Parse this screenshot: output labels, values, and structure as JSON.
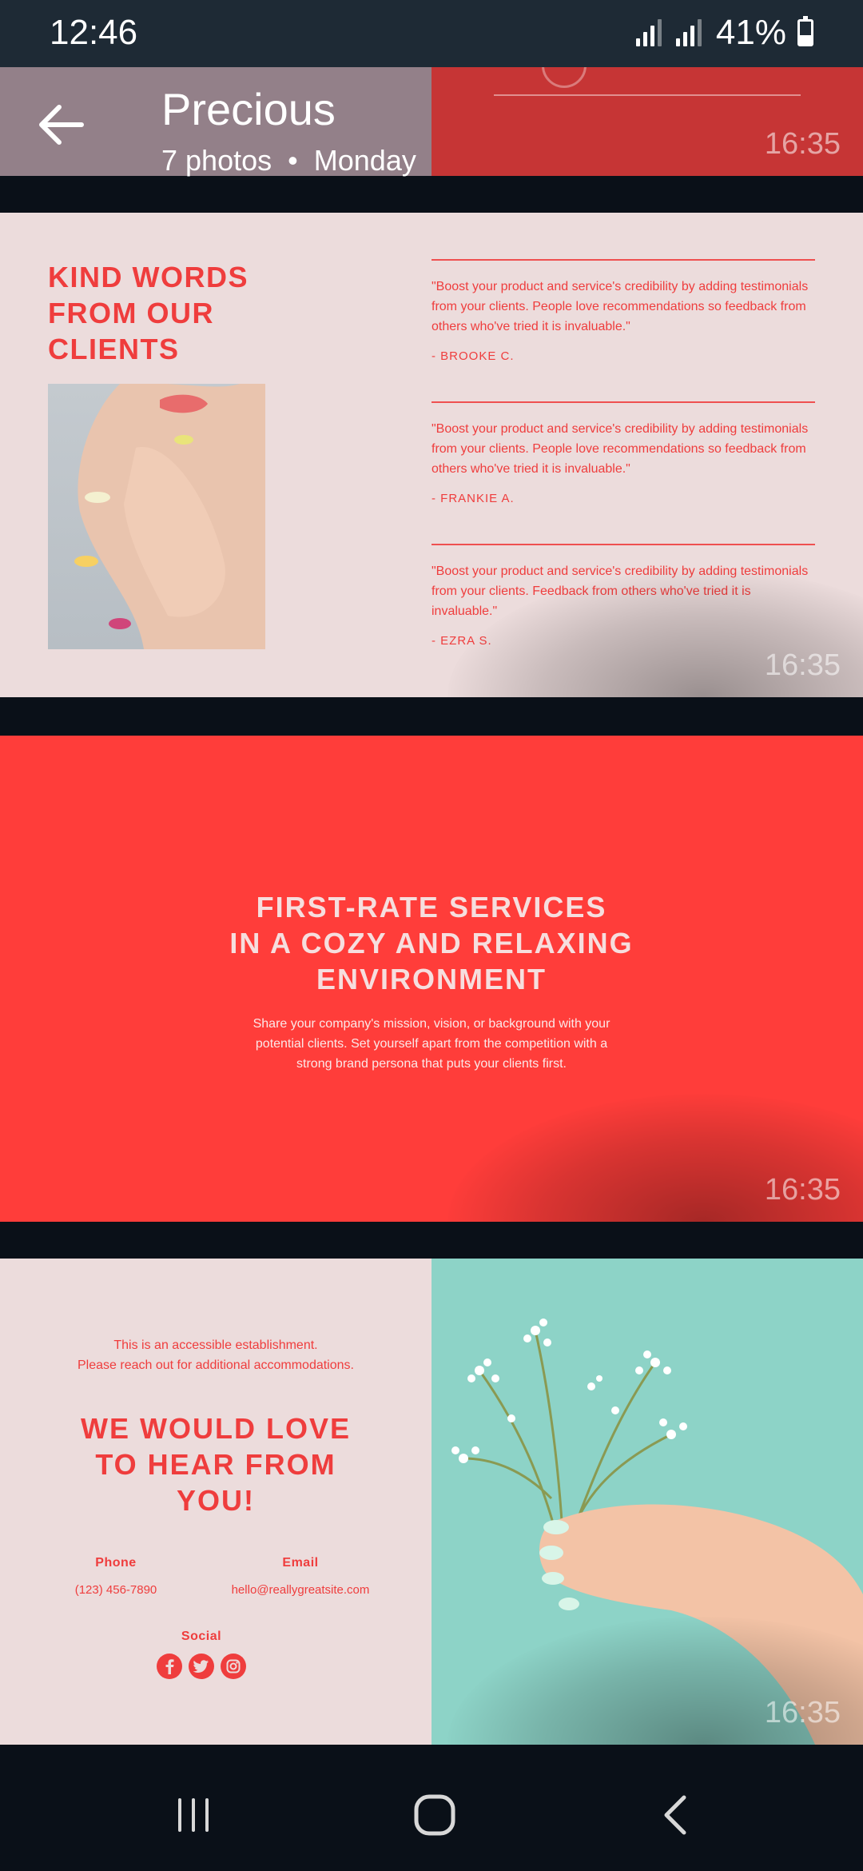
{
  "status_bar": {
    "time": "12:46",
    "battery": "41%",
    "battery_level": 0.41
  },
  "album": {
    "title": "Precious",
    "photo_count": "7 photos",
    "separator": "•",
    "date": "Monday"
  },
  "photos": [
    {
      "time": "16:35"
    },
    {
      "time": "16:35",
      "heading": "KIND WORDS FROM OUR CLIENTS",
      "testimonials": [
        {
          "quote": "\"Boost your product and service's credibility by adding testimonials from your clients. People love recommendations so feedback from others who've tried it is invaluable.\"",
          "author": "- BROOKE C."
        },
        {
          "quote": "\"Boost your product and service's credibility by adding testimonials from your clients. People love recommendations so feedback from others who've tried it is invaluable.\"",
          "author": "- FRANKIE A."
        },
        {
          "quote": "\"Boost your product and service's credibility by adding testimonials from your clients. Feedback from others who've tried it is invaluable.\"",
          "author": "- EZRA S."
        }
      ]
    },
    {
      "time": "16:35",
      "heading_lines": [
        "FIRST-RATE SERVICES",
        "IN A COZY AND RELAXING",
        "ENVIRONMENT"
      ],
      "body_lines": [
        "Share your company's mission, vision, or background with your",
        "potential clients. Set yourself apart from the competition with a",
        "strong brand persona that puts your clients first."
      ]
    },
    {
      "time": "16:35",
      "access_lines": [
        "This is an accessible establishment.",
        "Please reach out for additional accommodations."
      ],
      "heading_lines": [
        "WE WOULD LOVE",
        "TO HEAR FROM",
        "YOU!"
      ],
      "phone_label": "Phone",
      "phone": "(123) 456-7890",
      "email_label": "Email",
      "email": "hello@reallygreatsite.com",
      "social_label": "Social",
      "social_icons": [
        "facebook-icon",
        "twitter-icon",
        "instagram-icon"
      ]
    }
  ],
  "colors": {
    "accent_red": "#ef3d3d",
    "service_red": "#ff3d3a",
    "blush": "#ecdcdc",
    "mint": "#8dd3c7",
    "status_bar": "#1e2a35"
  },
  "nav": {
    "recents_icon": "recents-icon",
    "home_icon": "home-icon",
    "back_icon": "back-icon"
  }
}
